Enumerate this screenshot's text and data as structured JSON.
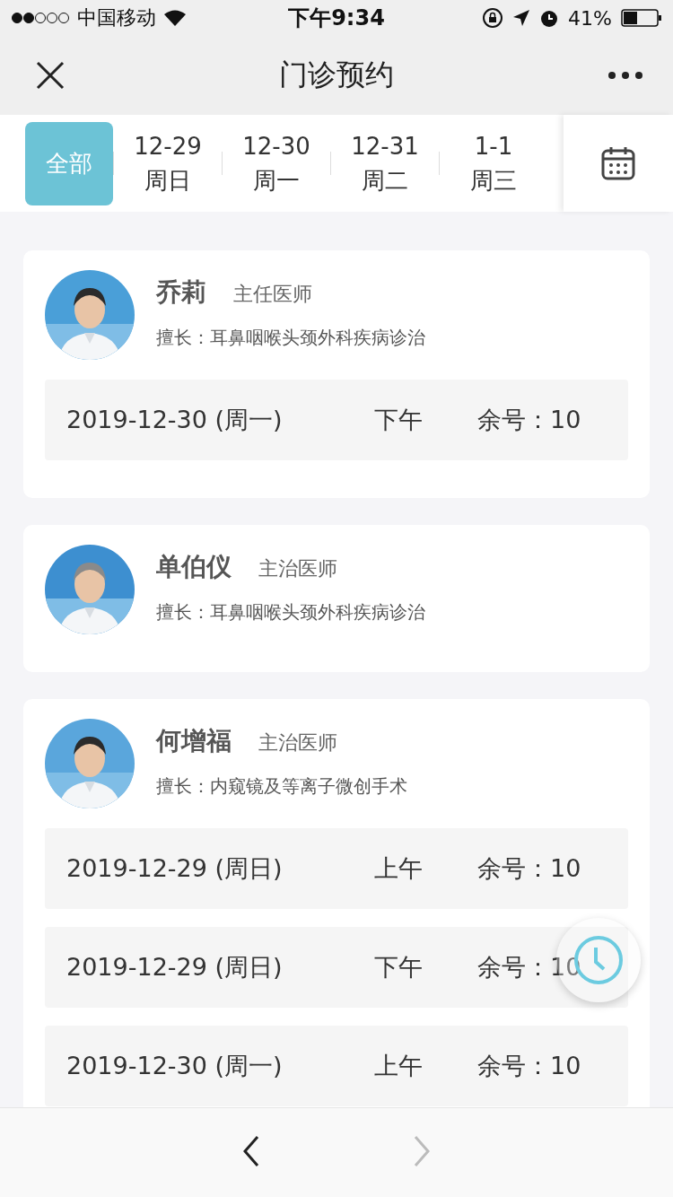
{
  "status_bar": {
    "carrier": "中国移动",
    "time": "下午9:34",
    "battery": "41%"
  },
  "header": {
    "title": "门诊预约"
  },
  "date_tabs": [
    {
      "label": "全部",
      "selected": true
    },
    {
      "date": "12-29",
      "weekday": "周日",
      "selected": false
    },
    {
      "date": "12-30",
      "weekday": "周一",
      "selected": false
    },
    {
      "date": "12-31",
      "weekday": "周二",
      "selected": false
    },
    {
      "date": "1-1",
      "weekday": "周三",
      "selected": false
    }
  ],
  "doctors": [
    {
      "name": "乔莉",
      "title": "主任医师",
      "specialty": "擅长：耳鼻咽喉头颈外科疾病诊治",
      "slots": [
        {
          "date": "2019-12-30 (周一)",
          "period": "下午",
          "remaining": "余号：10"
        }
      ]
    },
    {
      "name": "单伯仪",
      "title": "主治医师",
      "specialty": "擅长：耳鼻咽喉头颈外科疾病诊治"
    },
    {
      "name": "何增福",
      "title": "主治医师",
      "specialty": "擅长：内窥镜及等离子微创手术",
      "slots": [
        {
          "date": "2019-12-29 (周日)",
          "period": "上午",
          "remaining": "余号：10"
        },
        {
          "date": "2019-12-29 (周日)",
          "period": "下午",
          "remaining": "余号：10"
        },
        {
          "date": "2019-12-30 (周一)",
          "period": "上午",
          "remaining": "余号：10"
        }
      ]
    }
  ],
  "bottom_nav": [
    {
      "kind": "back",
      "disabled": false
    },
    {
      "kind": "forward",
      "disabled": true
    }
  ]
}
